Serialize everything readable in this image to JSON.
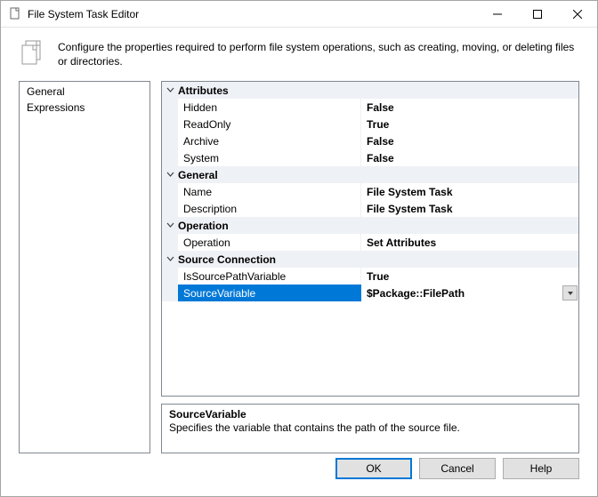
{
  "window": {
    "title": "File System Task Editor"
  },
  "header": {
    "description": "Configure the properties required to perform file system operations, such as creating, moving, or deleting files or directories."
  },
  "nav": {
    "items": [
      "General",
      "Expressions"
    ]
  },
  "grid": {
    "categories": [
      {
        "name": "Attributes",
        "props": [
          {
            "name": "Hidden",
            "value": "False"
          },
          {
            "name": "ReadOnly",
            "value": "True"
          },
          {
            "name": "Archive",
            "value": "False"
          },
          {
            "name": "System",
            "value": "False"
          }
        ]
      },
      {
        "name": "General",
        "props": [
          {
            "name": "Name",
            "value": "File System Task"
          },
          {
            "name": "Description",
            "value": "File System Task"
          }
        ]
      },
      {
        "name": "Operation",
        "props": [
          {
            "name": "Operation",
            "value": "Set Attributes"
          }
        ]
      },
      {
        "name": "Source Connection",
        "props": [
          {
            "name": "IsSourcePathVariable",
            "value": "True"
          },
          {
            "name": "SourceVariable",
            "value": "$Package::FilePath",
            "selected": true,
            "dropdown": true
          }
        ]
      }
    ]
  },
  "descPanel": {
    "title": "SourceVariable",
    "text": "Specifies the variable that contains the path of the source file."
  },
  "buttons": {
    "ok": "OK",
    "cancel": "Cancel",
    "help": "Help"
  }
}
